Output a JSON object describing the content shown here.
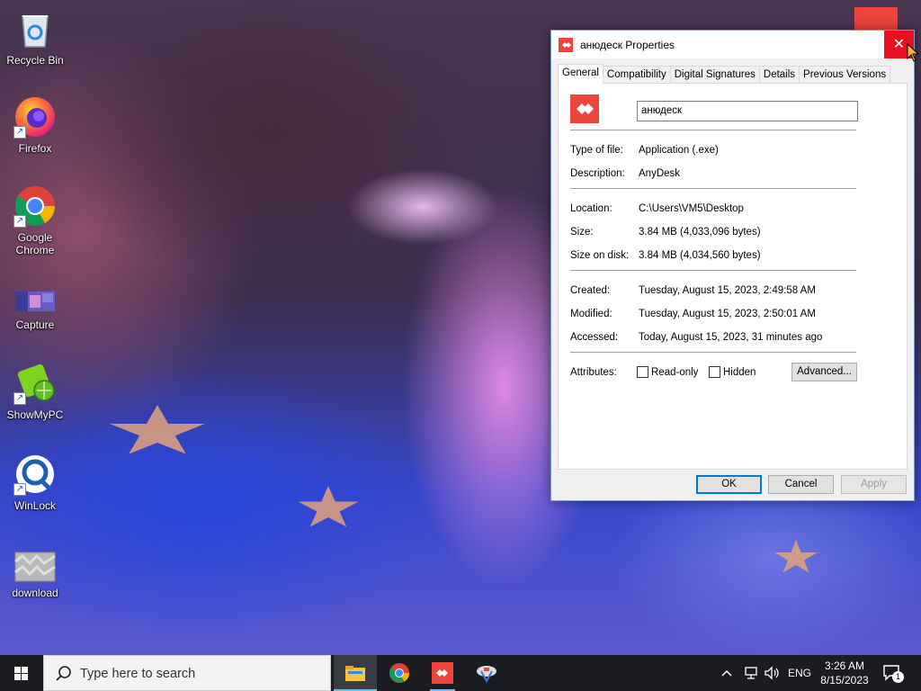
{
  "desktop": {
    "icons": [
      {
        "label": "Recycle Bin",
        "icon": "recycle-bin-icon"
      },
      {
        "label": "Firefox",
        "icon": "firefox-icon"
      },
      {
        "label": "Google Chrome",
        "icon": "chrome-icon"
      },
      {
        "label": "Capture",
        "icon": "capture-icon"
      },
      {
        "label": "ShowMyPC",
        "icon": "showmypc-icon"
      },
      {
        "label": "WinLock",
        "icon": "winlock-icon"
      },
      {
        "label": "download",
        "icon": "image-file-icon"
      }
    ]
  },
  "dialog": {
    "title": "анюдеск Properties",
    "close_label": "✕",
    "tabs": [
      "General",
      "Compatibility",
      "Digital Signatures",
      "Details",
      "Previous Versions"
    ],
    "active_tab": "General",
    "file_name": "анюдеск",
    "properties": {
      "type_label": "Type of file:",
      "type_value": "Application (.exe)",
      "description_label": "Description:",
      "description_value": "AnyDesk",
      "location_label": "Location:",
      "location_value": "C:\\Users\\VM5\\Desktop",
      "size_label": "Size:",
      "size_value": "3.84 MB (4,033,096 bytes)",
      "size_on_disk_label": "Size on disk:",
      "size_on_disk_value": "3.84 MB (4,034,560 bytes)",
      "created_label": "Created:",
      "created_value": "Tuesday, August 15, 2023, 2:49:58 AM",
      "modified_label": "Modified:",
      "modified_value": "Tuesday, August 15, 2023, 2:50:01 AM",
      "accessed_label": "Accessed:",
      "accessed_value": "Today, August 15, 2023, 31 minutes ago",
      "attributes_label": "Attributes:",
      "readonly_label": "Read-only",
      "readonly_checked": false,
      "hidden_label": "Hidden",
      "hidden_checked": false,
      "advanced_label": "Advanced..."
    },
    "buttons": {
      "ok": "OK",
      "cancel": "Cancel",
      "apply": "Apply"
    },
    "accent_color": "#ef443b"
  },
  "taskbar": {
    "search_placeholder": "Type here to search",
    "apps": [
      "file-explorer-icon",
      "chrome-icon",
      "anydesk-icon",
      "capture-icon"
    ],
    "language": "ENG",
    "time": "3:26 AM",
    "date": "8/15/2023",
    "notification_count": "1"
  }
}
